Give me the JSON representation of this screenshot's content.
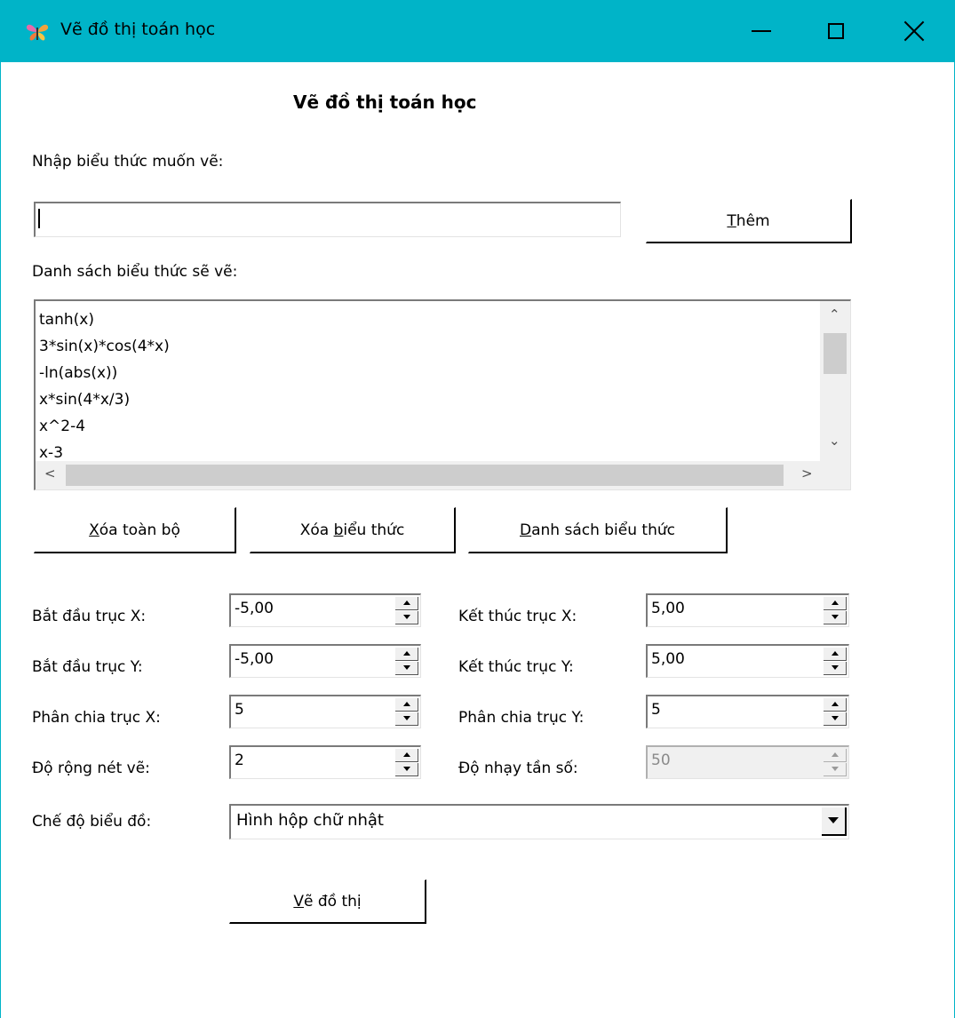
{
  "window": {
    "title": "Vẽ đồ thị toán học",
    "accent_color": "#00b4c8"
  },
  "header": {
    "title": "Vẽ đồ thị toán học"
  },
  "input_section": {
    "label": "Nhập biểu thức muốn vẽ:",
    "value": "",
    "add_button_prefix": "T",
    "add_button_rest": "hêm"
  },
  "list_section": {
    "label": "Danh sách biểu thức sẽ vẽ:",
    "items": [
      "tanh(x)",
      "3*sin(x)*cos(4*x)",
      "-ln(abs(x))",
      "x*sin(4*x/3)",
      "x^2-4",
      "x-3"
    ]
  },
  "actions": {
    "clear_all_key": "X",
    "clear_all_rest": "óa toàn bộ",
    "delete_pre": "Xóa ",
    "delete_key": "b",
    "delete_rest": "iểu thức",
    "list_key": "D",
    "list_rest": "anh sách biểu thức"
  },
  "fields": {
    "x_start": {
      "label": "Bắt đầu trục X:",
      "value": "-5,00"
    },
    "x_end": {
      "label": "Kết thúc trục X:",
      "value": "5,00"
    },
    "y_start": {
      "label": "Bắt đầu trục Y:",
      "value": "-5,00"
    },
    "y_end": {
      "label": "Kết thúc trục Y:",
      "value": "5,00"
    },
    "x_div": {
      "label": "Phân chia trục X:",
      "value": "5"
    },
    "y_div": {
      "label": "Phân chia trục Y:",
      "value": "5"
    },
    "line_width": {
      "label": "Độ rộng nét vẽ:",
      "value": "2"
    },
    "frequency": {
      "label": "Độ nhạy tần số:",
      "value": "50"
    }
  },
  "chart_mode": {
    "label": "Chế độ biểu đồ:",
    "value": "Hình hộp chữ nhật"
  },
  "draw_button": {
    "key": "V",
    "rest": "ẽ đồ thị"
  }
}
